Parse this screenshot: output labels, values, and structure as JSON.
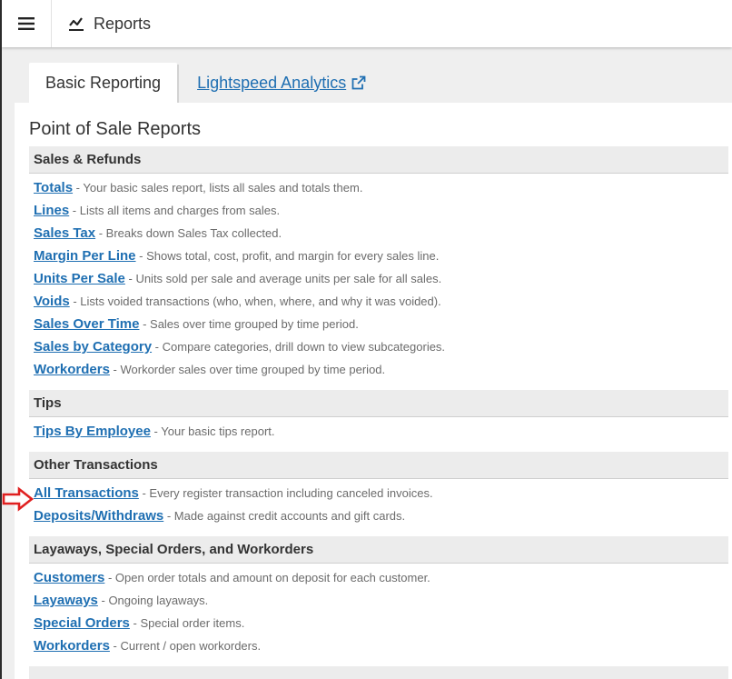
{
  "header": {
    "title": "Reports"
  },
  "tabs": {
    "active": "Basic Reporting",
    "external": "Lightspeed Analytics"
  },
  "report_title": "Point of Sale Reports",
  "sections": [
    {
      "title": "Sales & Refunds",
      "items": [
        {
          "link": "Totals",
          "desc": " - Your basic sales report, lists all sales and totals them."
        },
        {
          "link": "Lines",
          "desc": " - Lists all items and charges from sales."
        },
        {
          "link": "Sales Tax",
          "desc": " - Breaks down Sales Tax collected."
        },
        {
          "link": "Margin Per Line",
          "desc": " - Shows total, cost, profit, and margin for every sales line."
        },
        {
          "link": "Units Per Sale",
          "desc": " - Units sold per sale and average units per sale for all sales."
        },
        {
          "link": "Voids",
          "desc": " - Lists voided transactions (who, when, where, and why it was voided)."
        },
        {
          "link": "Sales Over Time",
          "desc": " - Sales over time grouped by time period."
        },
        {
          "link": "Sales by Category",
          "desc": " - Compare categories, drill down to view subcategories."
        },
        {
          "link": "Workorders",
          "desc": " - Workorder sales over time grouped by time period."
        }
      ]
    },
    {
      "title": "Tips",
      "items": [
        {
          "link": "Tips By Employee",
          "desc": " - Your basic tips report."
        }
      ]
    },
    {
      "title": "Other Transactions",
      "items": [
        {
          "link": "All Transactions",
          "desc": " - Every register transaction including canceled invoices."
        },
        {
          "link": "Deposits/Withdraws",
          "desc": " - Made against credit accounts and gift cards."
        }
      ]
    },
    {
      "title": "Layaways, Special Orders, and Workorders",
      "items": [
        {
          "link": "Customers",
          "desc": " - Open order totals and amount on deposit for each customer."
        },
        {
          "link": "Layaways",
          "desc": " - Ongoing layaways."
        },
        {
          "link": "Special Orders",
          "desc": " - Special order items."
        },
        {
          "link": "Workorders",
          "desc": " - Current / open workorders."
        }
      ]
    }
  ],
  "colors": {
    "link": "#1f6fb2",
    "arrow": "#e02020"
  },
  "icons": {
    "menu": "hamburger-icon",
    "reports": "line-chart-icon",
    "external": "external-link-icon",
    "marker": "red-arrow-icon"
  }
}
